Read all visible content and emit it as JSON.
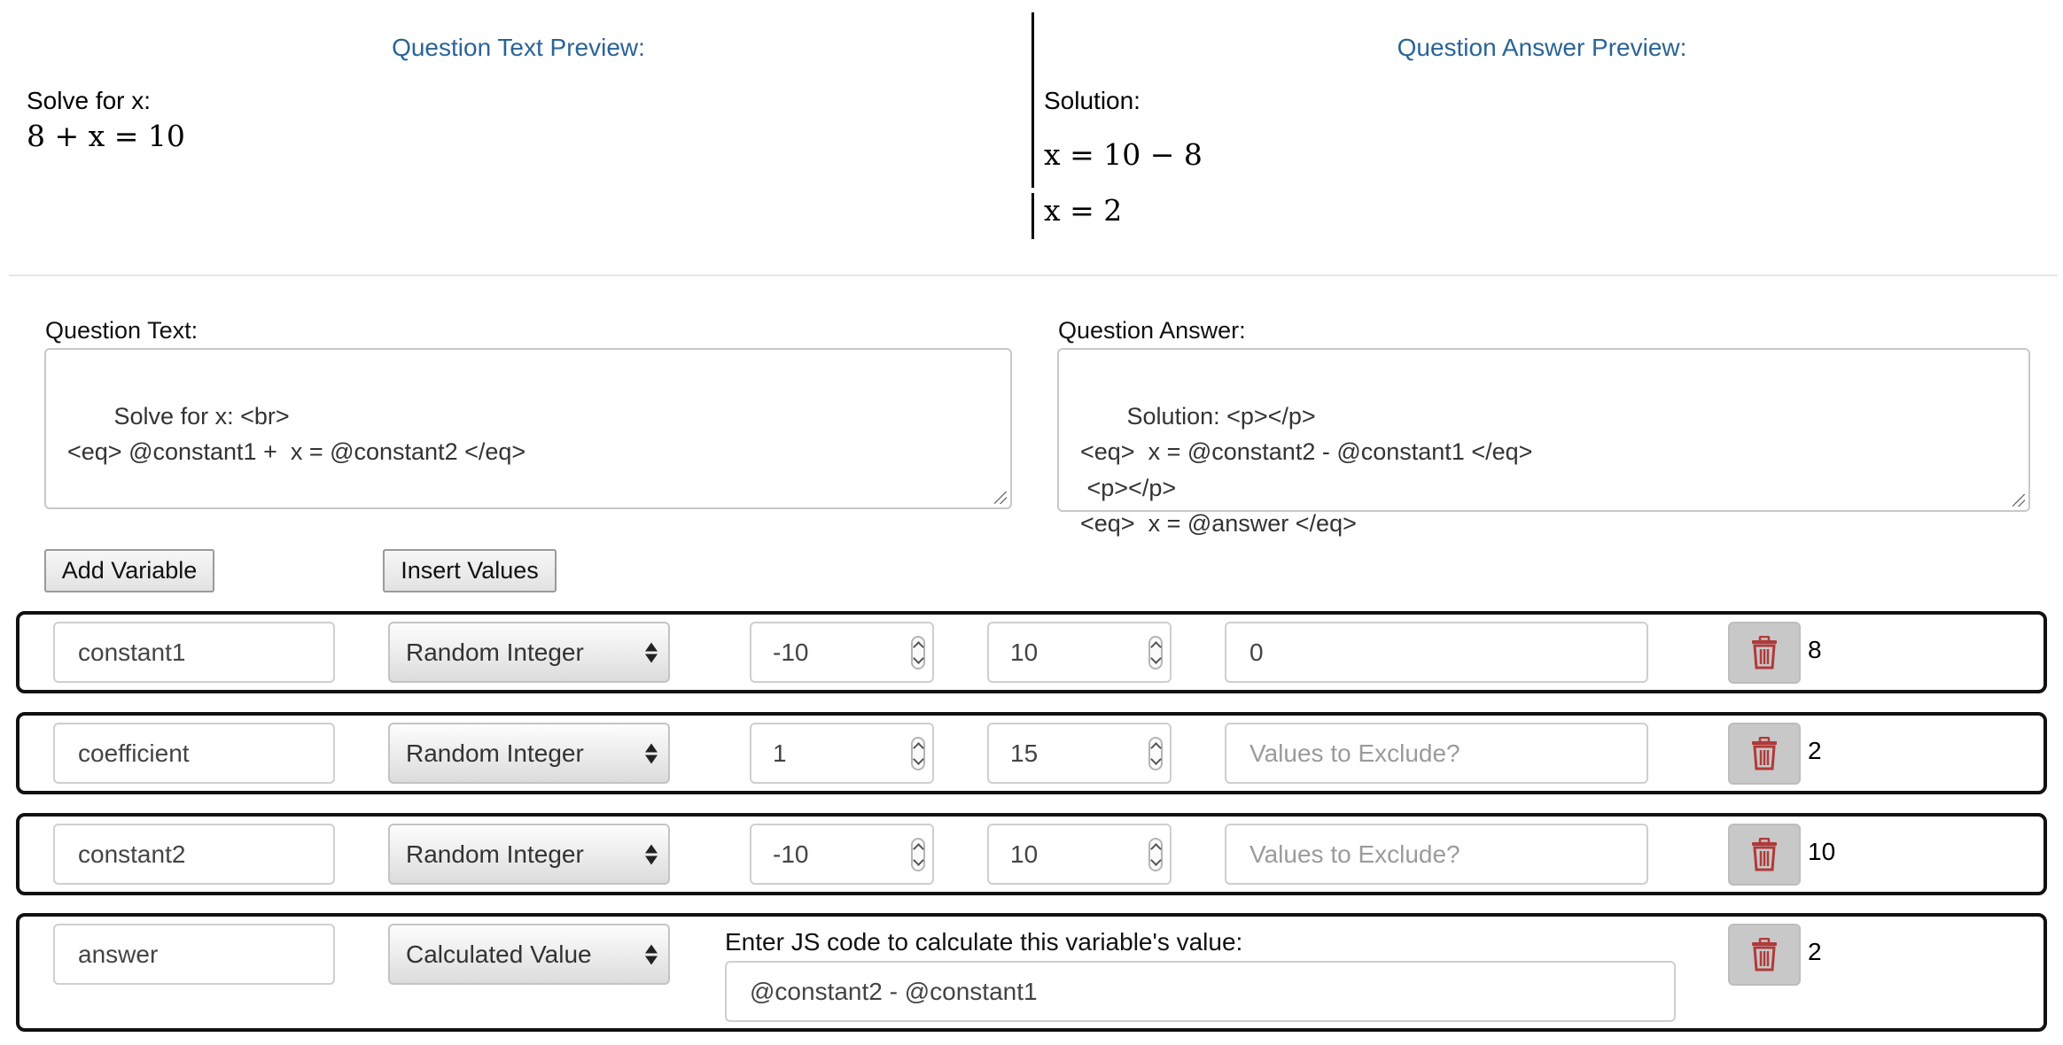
{
  "preview": {
    "text_heading": "Question Text Preview:",
    "answer_heading": "Question Answer Preview:",
    "question_line1": "Solve for x:",
    "question_math": "8 + x = 10",
    "answer_line1": "Solution:",
    "answer_math1": "x = 10 − 8",
    "answer_math2": "x = 2"
  },
  "editor": {
    "question_text_label": "Question Text:",
    "question_text_value": "     Solve for x: <br>\n<eq> @constant1 +  x = @constant2 </eq>",
    "question_answer_label": "Question Answer:",
    "question_answer_value": "     Solution: <p></p>\n<eq>  x = @constant2 - @constant1 </eq>\n <p></p>\n<eq>  x = @answer </eq>"
  },
  "buttons": {
    "add_variable": "Add Variable",
    "insert_values": "Insert Values"
  },
  "variables": [
    {
      "name": "constant1",
      "type": "Random Integer",
      "min": "-10",
      "max": "10",
      "exclude_value": "0",
      "exclude_placeholder": "Values to Exclude?",
      "result": "8"
    },
    {
      "name": "coefficient",
      "type": "Random Integer",
      "min": "1",
      "max": "15",
      "exclude_value": "",
      "exclude_placeholder": "Values to Exclude?",
      "result": "2"
    },
    {
      "name": "constant2",
      "type": "Random Integer",
      "min": "-10",
      "max": "10",
      "exclude_value": "",
      "exclude_placeholder": "Values to Exclude?",
      "result": "10"
    },
    {
      "name": "answer",
      "type": "Calculated Value",
      "js_label": "Enter JS code to calculate this variable's value:",
      "js_code": "@constant2 - @constant1",
      "result": "2"
    }
  ],
  "colors": {
    "heading": "#2a6496",
    "delete_icon": "#b03a3a",
    "delete_bg": "#c8c8c8"
  },
  "icons": {
    "delete": "trash-icon"
  }
}
